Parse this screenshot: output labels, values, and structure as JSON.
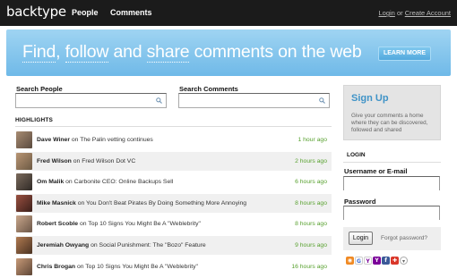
{
  "header": {
    "logo": "backtype",
    "nav": [
      "People",
      "Comments"
    ],
    "login_link": "Login",
    "or_text": "or",
    "create_account_link": "Create Account"
  },
  "banner": {
    "title_parts": [
      "Find",
      ",",
      "follow",
      " and ",
      "share",
      " comments on the web"
    ],
    "button": "LEARN MORE"
  },
  "search": {
    "people_label": "Search People",
    "comments_label": "Search Comments"
  },
  "highlights": {
    "heading": "HIGHLIGHTS",
    "connector": "on",
    "items": [
      {
        "name": "Dave Winer",
        "topic": "The Palin vetting continues",
        "time": "1 hour ago"
      },
      {
        "name": "Fred Wilson",
        "topic": "Fred Wilson Dot VC",
        "time": "2 hours ago"
      },
      {
        "name": "Om Malik",
        "topic": "Carbonite CEO: Online Backups Sell",
        "time": "6 hours ago"
      },
      {
        "name": "Mike Masnick",
        "topic": "You Don't Beat Pirates By Doing Something More Annoying",
        "time": "8 hours ago"
      },
      {
        "name": "Robert Scoble",
        "topic": "Top 10 Signs You Might Be A \"Weblebrity\"",
        "time": "8 hours ago"
      },
      {
        "name": "Jeremiah Owyang",
        "topic": "Social Punishment: The \"Bozo\" Feature",
        "time": "9 hours ago"
      },
      {
        "name": "Chris Brogan",
        "topic": "Top 10 Signs You Might Be A \"Weblebrity\"",
        "time": "16 hours ago"
      }
    ]
  },
  "signup": {
    "title": "Sign Up",
    "description": "Give your comments a home where they can be discovered, followed and shared"
  },
  "login": {
    "heading": "LOGIN",
    "username_label": "Username or E-mail",
    "password_label": "Password",
    "button": "Login",
    "forgot": "Forgot password?"
  },
  "share_icons": [
    "rss-icon",
    "google-icon",
    "yahoo-icon",
    "myyahoo-icon",
    "facebook-icon",
    "live-icon",
    "more-icon"
  ],
  "colors": {
    "topbar": "#1b1b1b",
    "banner": "#7cc2ec",
    "time_green": "#58a12f",
    "signup_blue": "#3f93c7"
  }
}
